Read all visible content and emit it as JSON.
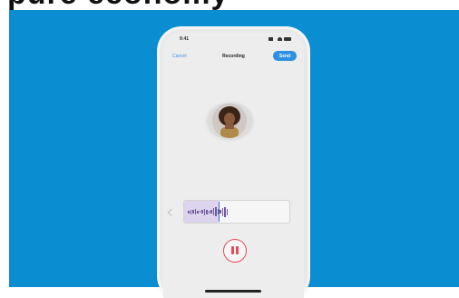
{
  "heading": {
    "text": "pure economy"
  },
  "colors": {
    "background": "#0a8dd1",
    "accent": "#2f8fe0",
    "record": "#e24a5a",
    "wave": "#6f5a9e"
  },
  "status_bar": {
    "time": "9:41"
  },
  "nav": {
    "cancel_label": "Cancel",
    "title": "Recording",
    "send_label": "Send"
  },
  "recording": {
    "progress": 0.33,
    "state": "recording"
  },
  "icons": {
    "pause": "pause-icon",
    "signal": "signal-icon",
    "wifi": "wifi-icon",
    "battery": "battery-icon"
  }
}
